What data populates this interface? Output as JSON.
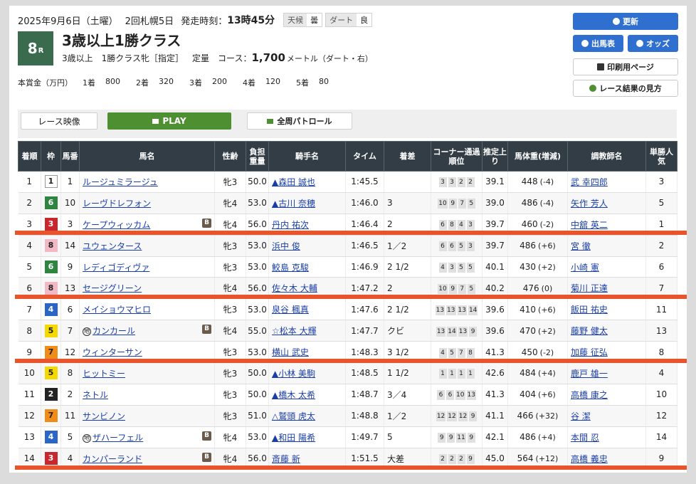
{
  "header": {
    "date": "2025年9月6日（土曜）",
    "meeting": "2回札幌5日",
    "start_label": "発走時刻：",
    "start_time": "13時45分",
    "weather_label": "天候",
    "weather": "曇",
    "track_label": "ダート",
    "track_condition": "良"
  },
  "race": {
    "number": "8",
    "number_suffix": "R",
    "title": "3歳以上1勝クラス",
    "condition": "3歳以上　1勝クラス牝［指定］",
    "weight_rule": "定量",
    "course_label": "コース：",
    "distance": "1,700",
    "distance_unit": "メートル（ダート・右）"
  },
  "prize": {
    "label": "本賞金（万円）",
    "items": [
      {
        "place": "1着",
        "amount": "800"
      },
      {
        "place": "2着",
        "amount": "320"
      },
      {
        "place": "3着",
        "amount": "200"
      },
      {
        "place": "4着",
        "amount": "120"
      },
      {
        "place": "5着",
        "amount": "80"
      }
    ]
  },
  "buttons": {
    "refresh": "更新",
    "entries": "出馬表",
    "odds": "オッズ",
    "print": "印刷用ページ",
    "howto": "レース結果の見方"
  },
  "video": {
    "label": "レース映像",
    "play": "PLAY",
    "patrol": "全周パトロール"
  },
  "table": {
    "headers": {
      "rank": "着順",
      "waku": "枠",
      "umaban": "馬番",
      "horse": "馬名",
      "sexage": "性齢",
      "weight": "負担重量",
      "jockey": "騎手名",
      "time": "タイム",
      "margin": "着差",
      "corner": "コーナー通過順位",
      "last3f": "推定上り",
      "bodyweight": "馬体重(増減)",
      "trainer": "調教師名",
      "pop": "単勝人気"
    },
    "rows": [
      {
        "rank": "1",
        "waku": "1",
        "umaban": "1",
        "mark": "",
        "horse": "ルージュミラージュ",
        "blinker": false,
        "sexage": "牝3",
        "weight": "50.0",
        "jockey": "▲森田 誠也",
        "time": "1:45.5",
        "margin": "",
        "corner": [
          "3",
          "3",
          "2",
          "2"
        ],
        "last3f": "39.1",
        "bw": "448",
        "bwd": "(-4)",
        "trainer": "武 幸四郎",
        "pop": "3"
      },
      {
        "rank": "2",
        "waku": "6",
        "umaban": "10",
        "mark": "",
        "horse": "レーヴドレフォン",
        "blinker": false,
        "sexage": "牝4",
        "weight": "53.0",
        "jockey": "▲古川 奈穂",
        "time": "1:46.0",
        "margin": "3",
        "corner": [
          "10",
          "9",
          "7",
          "5"
        ],
        "last3f": "39.0",
        "bw": "486",
        "bwd": "(-4)",
        "trainer": "矢作 芳人",
        "pop": "5"
      },
      {
        "rank": "3",
        "waku": "3",
        "umaban": "3",
        "mark": "",
        "horse": "ケープウィッカム",
        "blinker": true,
        "sexage": "牝4",
        "weight": "56.0",
        "jockey": "丹内 祐次",
        "time": "1:46.4",
        "margin": "2",
        "corner": [
          "6",
          "8",
          "4",
          "3"
        ],
        "last3f": "39.7",
        "bw": "460",
        "bwd": "(-2)",
        "trainer": "中舘 英二",
        "pop": "1"
      },
      {
        "rank": "4",
        "waku": "8",
        "umaban": "14",
        "mark": "",
        "horse": "ユウェンタース",
        "blinker": false,
        "sexage": "牝3",
        "weight": "53.0",
        "jockey": "浜中 俊",
        "time": "1:46.5",
        "margin": "1／2",
        "corner": [
          "6",
          "6",
          "5",
          "3"
        ],
        "last3f": "39.7",
        "bw": "486",
        "bwd": "(+6)",
        "trainer": "宮 徹",
        "pop": "2"
      },
      {
        "rank": "5",
        "waku": "6",
        "umaban": "9",
        "mark": "",
        "horse": "レディゴディヴァ",
        "blinker": false,
        "sexage": "牝3",
        "weight": "53.0",
        "jockey": "鮫島 克駿",
        "time": "1:46.9",
        "margin": "2 1/2",
        "corner": [
          "4",
          "3",
          "5",
          "5"
        ],
        "last3f": "40.1",
        "bw": "430",
        "bwd": "(+2)",
        "trainer": "小崎 憲",
        "pop": "6"
      },
      {
        "rank": "6",
        "waku": "8",
        "umaban": "13",
        "mark": "",
        "horse": "セージグリーン",
        "blinker": false,
        "sexage": "牝4",
        "weight": "56.0",
        "jockey": "佐々木 大輔",
        "time": "1:47.2",
        "margin": "2",
        "corner": [
          "10",
          "9",
          "7",
          "5"
        ],
        "last3f": "40.2",
        "bw": "476",
        "bwd": "(0)",
        "trainer": "菊川 正達",
        "pop": "7"
      },
      {
        "rank": "7",
        "waku": "4",
        "umaban": "6",
        "mark": "",
        "horse": "メイショウマヒロ",
        "blinker": false,
        "sexage": "牝3",
        "weight": "53.0",
        "jockey": "泉谷 楓真",
        "time": "1:47.6",
        "margin": "2 1/2",
        "corner": [
          "13",
          "13",
          "13",
          "14"
        ],
        "last3f": "39.6",
        "bw": "410",
        "bwd": "(+6)",
        "trainer": "飯田 祐史",
        "pop": "11"
      },
      {
        "rank": "8",
        "waku": "5",
        "umaban": "7",
        "mark": "地",
        "horse": "カンカール",
        "blinker": true,
        "sexage": "牝4",
        "weight": "55.0",
        "jockey": "☆松本 大輝",
        "time": "1:47.7",
        "margin": "クビ",
        "corner": [
          "13",
          "14",
          "13",
          "9"
        ],
        "last3f": "39.6",
        "bw": "470",
        "bwd": "(+2)",
        "trainer": "藤野 健太",
        "pop": "13"
      },
      {
        "rank": "9",
        "waku": "7",
        "umaban": "12",
        "mark": "",
        "horse": "ウィンターサン",
        "blinker": false,
        "sexage": "牝3",
        "weight": "53.0",
        "jockey": "横山 武史",
        "time": "1:48.3",
        "margin": "3 1/2",
        "corner": [
          "4",
          "5",
          "7",
          "8"
        ],
        "last3f": "41.3",
        "bw": "450",
        "bwd": "(-2)",
        "trainer": "加藤 征弘",
        "pop": "8"
      },
      {
        "rank": "10",
        "waku": "5",
        "umaban": "8",
        "mark": "",
        "horse": "ヒットミー",
        "blinker": false,
        "sexage": "牝3",
        "weight": "50.0",
        "jockey": "▲小林 美駒",
        "time": "1:48.5",
        "margin": "1 1/2",
        "corner": [
          "1",
          "1",
          "1",
          "1"
        ],
        "last3f": "42.6",
        "bw": "484",
        "bwd": "(+4)",
        "trainer": "鹿戸 雄一",
        "pop": "4"
      },
      {
        "rank": "11",
        "waku": "2",
        "umaban": "2",
        "mark": "",
        "horse": "ネトル",
        "blinker": false,
        "sexage": "牝3",
        "weight": "50.0",
        "jockey": "▲橋木 太希",
        "time": "1:48.7",
        "margin": "3／4",
        "corner": [
          "6",
          "6",
          "10",
          "13"
        ],
        "last3f": "41.3",
        "bw": "404",
        "bwd": "(+6)",
        "trainer": "高橋 康之",
        "pop": "10"
      },
      {
        "rank": "12",
        "waku": "7",
        "umaban": "11",
        "mark": "",
        "horse": "サンビノン",
        "blinker": false,
        "sexage": "牝3",
        "weight": "51.0",
        "jockey": "△鷲頭 虎太",
        "time": "1:48.8",
        "margin": "1／2",
        "corner": [
          "12",
          "12",
          "12",
          "9"
        ],
        "last3f": "41.1",
        "bw": "466",
        "bwd": "(+32)",
        "trainer": "谷 潔",
        "pop": "12"
      },
      {
        "rank": "13",
        "waku": "4",
        "umaban": "5",
        "mark": "地",
        "horse": "ザハーフェル",
        "blinker": true,
        "sexage": "牝4",
        "weight": "53.0",
        "jockey": "▲和田 陽希",
        "time": "1:49.7",
        "margin": "5",
        "corner": [
          "9",
          "9",
          "11",
          "9"
        ],
        "last3f": "42.1",
        "bw": "486",
        "bwd": "(+4)",
        "trainer": "本間 忍",
        "pop": "14"
      },
      {
        "rank": "14",
        "waku": "3",
        "umaban": "4",
        "mark": "",
        "horse": "カンパーランド",
        "blinker": true,
        "sexage": "牝4",
        "weight": "56.0",
        "jockey": "斎藤 新",
        "time": "1:51.5",
        "margin": "大差",
        "corner": [
          "2",
          "2",
          "2",
          "9"
        ],
        "last3f": "45.0",
        "bw": "564",
        "bwd": "(+12)",
        "trainer": "高橋 義忠",
        "pop": "9"
      }
    ]
  },
  "colors": {
    "highlight_line": "#e8542b",
    "header_bg": "#333d45",
    "play_green": "#4e8f32",
    "button_blue": "#2f6fcf"
  }
}
